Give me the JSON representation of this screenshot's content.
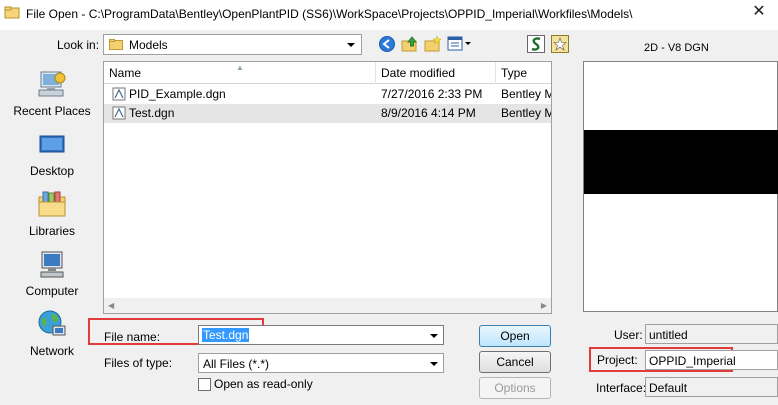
{
  "window": {
    "title": "File Open - C:\\ProgramData\\Bentley\\OpenPlantPID (SS6)\\WorkSpace\\Projects\\OPPID_Imperial\\Workfiles\\Models\\",
    "close_glyph": "✕"
  },
  "toolbar": {
    "look_in_label": "Look in:",
    "look_in_value": "Models"
  },
  "places": [
    {
      "label": "Recent Places",
      "icon": "recent-places-icon"
    },
    {
      "label": "Desktop",
      "icon": "desktop-icon"
    },
    {
      "label": "Libraries",
      "icon": "libraries-icon"
    },
    {
      "label": "Computer",
      "icon": "computer-icon"
    },
    {
      "label": "Network",
      "icon": "network-icon"
    }
  ],
  "file_list": {
    "columns": [
      "Name",
      "Date modified",
      "Type"
    ],
    "rows": [
      {
        "name": "PID_Example.dgn",
        "date": "7/27/2016 2:33 PM",
        "type": "Bentley M"
      },
      {
        "name": "Test.dgn",
        "date": "8/9/2016 4:14 PM",
        "type": "Bentley M",
        "selected": true
      }
    ]
  },
  "form": {
    "file_name_label": "File name:",
    "file_name_value": "Test.dgn",
    "file_type_label": "Files of type:",
    "file_type_value": "All Files (*.*)",
    "readonly_label": "Open as read-only"
  },
  "buttons": {
    "open": "Open",
    "cancel": "Cancel",
    "options": "Options"
  },
  "preview": {
    "label": "2D - V8 DGN"
  },
  "right_panel": {
    "user_label": "User:",
    "user_value": "untitled",
    "project_label": "Project:",
    "project_value": "OPPID_Imperial",
    "interface_label": "Interface:",
    "interface_value": "Default"
  },
  "colors": {
    "highlight_box": "#e03c3c",
    "selection": "#3399ff"
  }
}
